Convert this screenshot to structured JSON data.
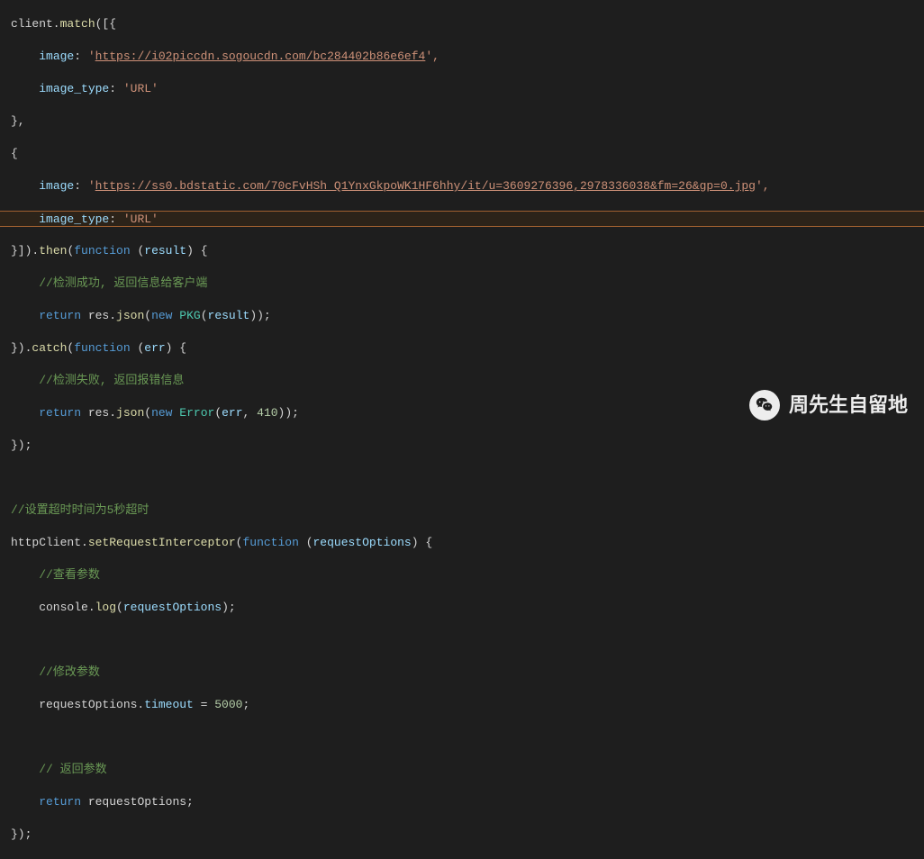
{
  "code": {
    "l1": {
      "a": "client.",
      "b": "match",
      "c": "([{"
    },
    "l2": {
      "a": "    ",
      "b": "image",
      "c": ": ",
      "d": "'",
      "e": "https://i02piccdn.sogoucdn.com/bc284402b86e6ef4",
      "f": "',",
      "g": ""
    },
    "l3": {
      "a": "    ",
      "b": "image_type",
      "c": ": ",
      "d": "'URL'"
    },
    "l4": {
      "a": "},"
    },
    "l5": {
      "a": "{"
    },
    "l6": {
      "a": "    ",
      "b": "image",
      "c": ": ",
      "d": "'",
      "e": "https://ss0.bdstatic.com/70cFvHSh_Q1YnxGkpoWK1HF6hhy/it/u=3609276396,2978336038&fm=26&gp=0.jpg",
      "f": "',",
      "g": ""
    },
    "l7": {
      "a": "    ",
      "b": "image_type",
      "c": ": ",
      "d": "'URL'"
    },
    "l8": {
      "a": "}]).",
      "b": "then",
      "c": "(",
      "d": "function",
      "e": " (",
      "f": "result",
      "g": ") {"
    },
    "l9": {
      "a": "    ",
      "b": "//检测成功, 返回信息给客户端"
    },
    "l10": {
      "a": "    ",
      "b": "return",
      "c": " res.",
      "d": "json",
      "e": "(",
      "f": "new",
      "g": " ",
      "h": "PKG",
      "i": "(",
      "j": "result",
      "k": "));"
    },
    "l11": {
      "a": "}).",
      "b": "catch",
      "c": "(",
      "d": "function",
      "e": " (",
      "f": "err",
      "g": ") {"
    },
    "l12": {
      "a": "    ",
      "b": "//检测失败, 返回报错信息"
    },
    "l13": {
      "a": "    ",
      "b": "return",
      "c": " res.",
      "d": "json",
      "e": "(",
      "f": "new",
      "g": " ",
      "h": "Error",
      "i": "(",
      "j": "err",
      "k": ", ",
      "l": "410",
      "m": "));"
    },
    "l14": {
      "a": "});"
    },
    "l15": {
      "a": ""
    },
    "l16": {
      "a": "//设置超时时间为5秒超时"
    },
    "l17": {
      "a": "httpClient.",
      "b": "setRequestInterceptor",
      "c": "(",
      "d": "function",
      "e": " (",
      "f": "requestOptions",
      "g": ") {"
    },
    "l18": {
      "a": "    ",
      "b": "//查看参数"
    },
    "l19": {
      "a": "    console.",
      "b": "log",
      "c": "(",
      "d": "requestOptions",
      "e": ");"
    },
    "l20": {
      "a": ""
    },
    "l21": {
      "a": "    ",
      "b": "//修改参数"
    },
    "l22": {
      "a": "    requestOptions.",
      "b": "timeout",
      "c": " = ",
      "d": "5000",
      "e": ";"
    },
    "l23": {
      "a": ""
    },
    "l24": {
      "a": "    ",
      "b": "// 返回参数"
    },
    "l25": {
      "a": "    ",
      "b": "return",
      "c": " requestOptions;"
    },
    "l26": {
      "a": "});"
    }
  },
  "watermark": {
    "text": "周先生自留地"
  }
}
